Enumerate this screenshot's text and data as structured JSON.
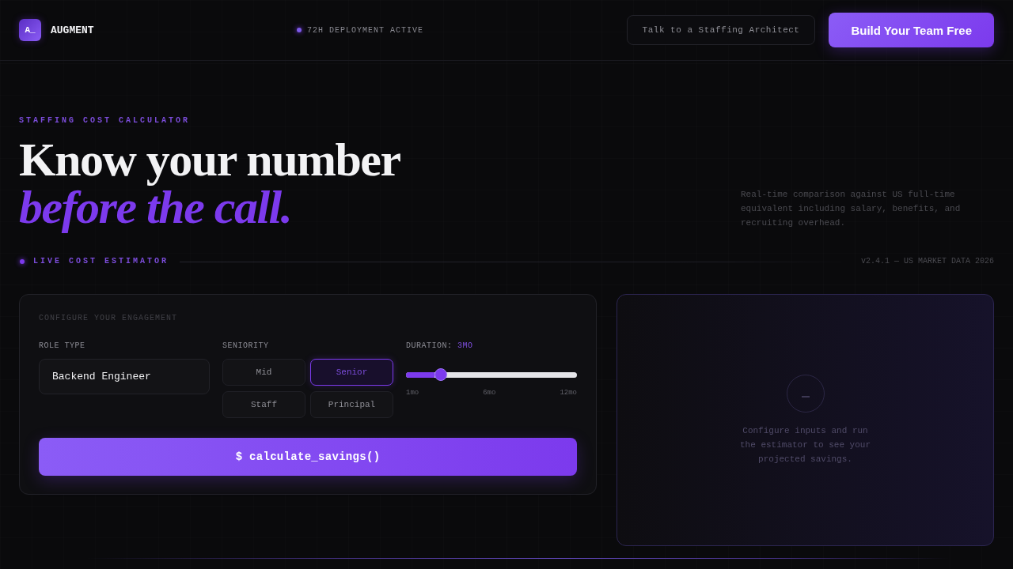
{
  "header": {
    "logo": {
      "mark": "A_",
      "name": "AUGMENT"
    },
    "status": "72H DEPLOYMENT ACTIVE",
    "buttons": [
      {
        "label": "Talk to a Staffing Architect",
        "kind": "outline"
      },
      {
        "label": "Build Your Team Free",
        "kind": "primary"
      }
    ]
  },
  "hero": {
    "eyebrow": "STAFFING COST CALCULATOR",
    "title_line_1": "Know your number",
    "title_line_2": "before the call.",
    "description": "Real-time comparison against US full-time equivalent including salary, benefits, and recruiting overhead."
  },
  "estimator_bar": {
    "label": "LIVE COST ESTIMATOR",
    "version": "v2.4.1 — US MARKET DATA 2026"
  },
  "config_card": {
    "title": "CONFIGURE YOUR ENGAGEMENT",
    "role": {
      "label": "ROLE TYPE",
      "value": "Backend Engineer"
    },
    "seniority": {
      "label": "SENIORITY",
      "options": [
        {
          "label": "Mid",
          "selected": false
        },
        {
          "label": "Senior",
          "selected": true
        },
        {
          "label": "Staff",
          "selected": false
        },
        {
          "label": "Principal",
          "selected": false
        }
      ]
    },
    "duration": {
      "label": "DURATION:",
      "value": "3MO",
      "level": 0.18,
      "ticks": [
        "1mo",
        "6mo",
        "12mo"
      ]
    },
    "run_button": "$ calculate_savings()"
  },
  "results_card": {
    "message": "Configure inputs and run the estimator to see your projected savings."
  }
}
